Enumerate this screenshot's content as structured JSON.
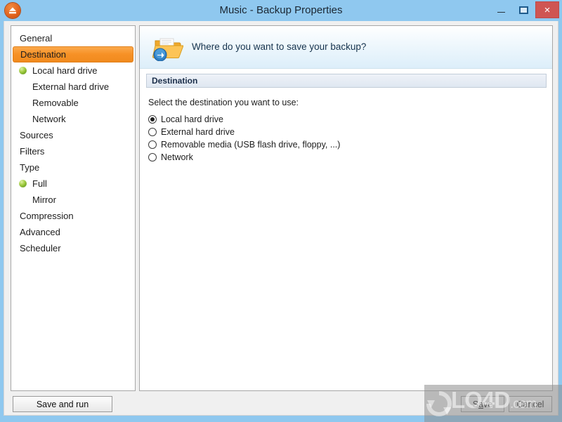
{
  "window": {
    "title": "Music - Backup Properties",
    "app_icon": "eject-disc-icon",
    "controls": {
      "minimize": "minimize-icon",
      "maximize": "restore-icon",
      "close": "×"
    },
    "colors": {
      "titlebar": "#8fc8ef",
      "close_button": "#cf5552",
      "accent_selected": "#f79126",
      "bullet_green": "#74a820"
    }
  },
  "sidebar": {
    "items": [
      {
        "label": "General",
        "level": "top",
        "selected": false,
        "bullet": false
      },
      {
        "label": "Destination",
        "level": "top",
        "selected": true,
        "bullet": false
      },
      {
        "label": "Local hard drive",
        "level": "sub",
        "selected": false,
        "bullet": true
      },
      {
        "label": "External hard drive",
        "level": "sub",
        "selected": false,
        "bullet": false
      },
      {
        "label": "Removable",
        "level": "sub",
        "selected": false,
        "bullet": false
      },
      {
        "label": "Network",
        "level": "sub",
        "selected": false,
        "bullet": false
      },
      {
        "label": "Sources",
        "level": "top",
        "selected": false,
        "bullet": false
      },
      {
        "label": "Filters",
        "level": "top",
        "selected": false,
        "bullet": false
      },
      {
        "label": "Type",
        "level": "top",
        "selected": false,
        "bullet": false
      },
      {
        "label": "Full",
        "level": "sub",
        "selected": false,
        "bullet": true
      },
      {
        "label": "Mirror",
        "level": "sub",
        "selected": false,
        "bullet": false
      },
      {
        "label": "Compression",
        "level": "top",
        "selected": false,
        "bullet": false
      },
      {
        "label": "Advanced",
        "level": "top",
        "selected": false,
        "bullet": false
      },
      {
        "label": "Scheduler",
        "level": "top",
        "selected": false,
        "bullet": false
      }
    ]
  },
  "content": {
    "header_icon": "open-folder-with-arrow-icon",
    "header_question": "Where do you want to save your backup?",
    "section_title": "Destination",
    "prompt": "Select the destination you want to use:",
    "options": [
      {
        "label": "Local hard drive",
        "checked": true
      },
      {
        "label": "External hard drive",
        "checked": false
      },
      {
        "label": "Removable media (USB flash drive, floppy, ...)",
        "checked": false
      },
      {
        "label": "Network",
        "checked": false
      }
    ]
  },
  "footer": {
    "save_and_run": "Save and run",
    "save_pre": "S",
    "save_accel": "a",
    "save_post": "ve",
    "cancel": "Cancel"
  },
  "watermark": {
    "text": "LO4D",
    "domain": ".com",
    "logo": "circular-arrows-icon"
  }
}
